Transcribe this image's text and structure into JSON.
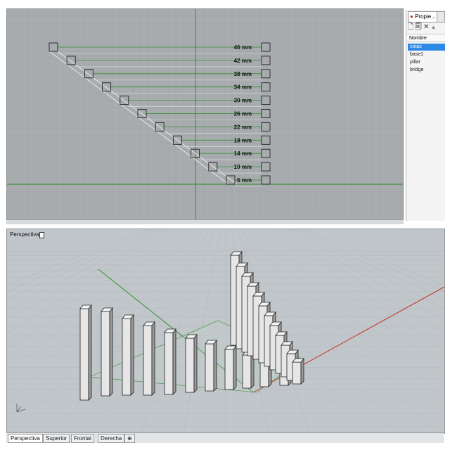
{
  "top_viewport": {
    "dimension_labels": [
      "46 mm",
      "42 mm",
      "38 mm",
      "34 mm",
      "30 mm",
      "26 mm",
      "22 mm",
      "18 mm",
      "14 mm",
      "10 mm",
      "6 mm"
    ]
  },
  "layers_panel": {
    "tab_label": "Propie...",
    "header": "Nombre",
    "layers": [
      {
        "name": "cotas",
        "selected": true
      },
      {
        "name": "base1",
        "selected": false
      },
      {
        "name": "pillar",
        "selected": false
      },
      {
        "name": "bridge",
        "selected": false
      }
    ]
  },
  "bottom_viewport": {
    "label": "Perspectiva",
    "tabs": [
      {
        "label": "Perspectiva",
        "active": true
      },
      {
        "label": "Superior",
        "active": false
      },
      {
        "label": "Frontal",
        "active": false
      },
      {
        "label": "Derecha",
        "active": false
      },
      {
        "label": "⊕",
        "active": false
      }
    ]
  },
  "colors": {
    "viewport_bg": "#a9acaf",
    "grid_line": "#9ea1a4",
    "axis_green": "#2f8f2f",
    "axis_red": "#c0392b",
    "selection_blue": "#2e8ae6"
  }
}
